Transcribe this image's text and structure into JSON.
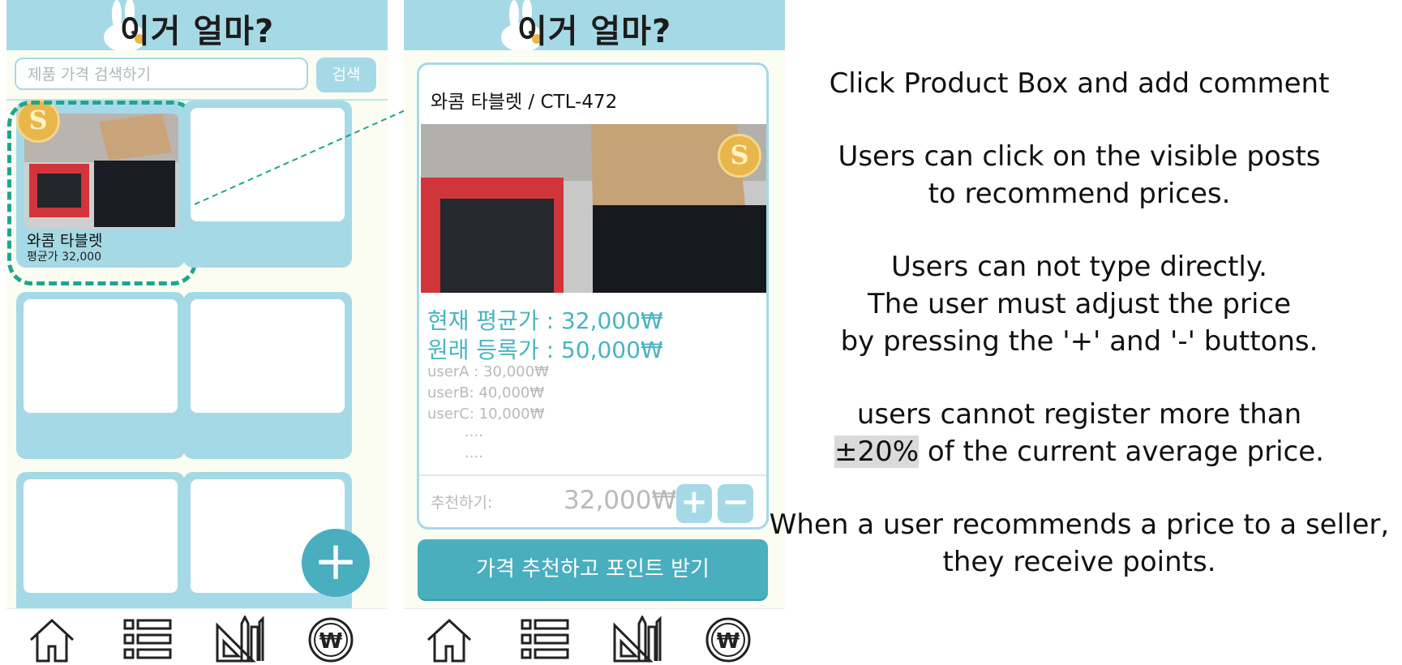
{
  "app": {
    "title": "이거 얼마?"
  },
  "search": {
    "placeholder": "제품 가격 검색하기",
    "button_label": "검색"
  },
  "featured_card": {
    "name": "와콤 타블렛",
    "avg_price": "평균가 32,000",
    "badge": "S"
  },
  "detail": {
    "title": "와콤 타블렛 / CTL-472",
    "badge": "S",
    "avg_price_line": "현재 평균가 : 32,000₩",
    "orig_price_line": "원래 등록가 : 50,000₩",
    "comments": [
      "userA : 30,000₩",
      "userB: 40,000₩",
      "userC: 10,000₩"
    ],
    "ellipsis": [
      "....",
      "...."
    ],
    "recommend_label": "추천하기:",
    "recommend_value": "32,000₩",
    "plus_label": "+",
    "minus_label": "−",
    "cta_label": "가격 추천하고 포인트 받기"
  },
  "fab": {
    "label": "+"
  },
  "nav": {
    "items": [
      "home-icon",
      "list-icon",
      "tools-icon",
      "won-coin-icon"
    ]
  },
  "annotation": {
    "title": "Click Product Box and add comment",
    "p1": [
      "Users can click on the visible posts",
      "to recommend prices."
    ],
    "p2": [
      "Users can not type directly.",
      "The user must adjust the price",
      "by pressing the '+' and '-' buttons."
    ],
    "p3_line1": "users cannot register more than",
    "p3_highlight": "±20%",
    "p3_rest": " of the current average price.",
    "p4": [
      "When a user recommends a price to a seller,",
      "they receive points."
    ]
  },
  "colors": {
    "header": "#a6d9e6",
    "accent": "#49aebe",
    "highlight_dash": "#1fa58f",
    "coin": "#e8b64b"
  }
}
